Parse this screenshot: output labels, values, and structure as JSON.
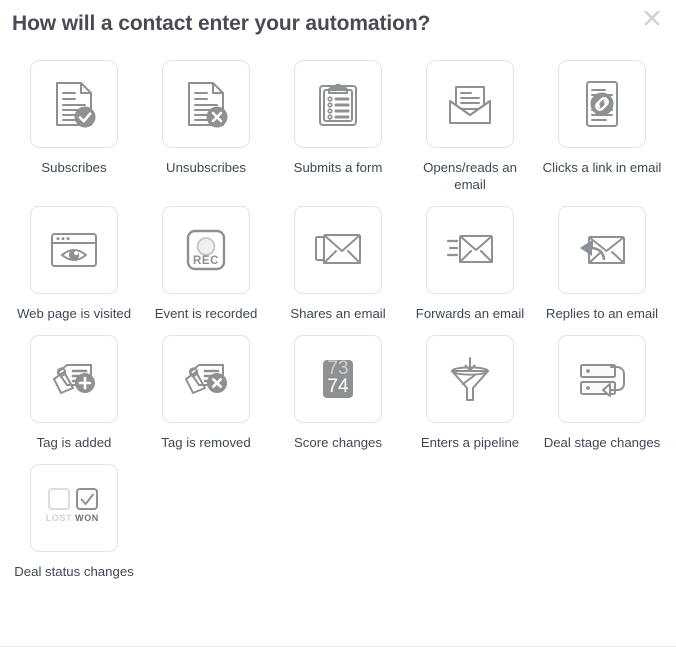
{
  "header": {
    "title": "How will a contact enter your automation?",
    "close_label": "×",
    "close_icon": "close-icon"
  },
  "colors": {
    "icon_stroke": "#8e9194",
    "icon_fill_gray": "#8e9194",
    "card_border": "#e3e3e3",
    "label_text": "#3e4855",
    "title_text": "#4a4a54",
    "close_icon": "#d2d2d2",
    "background": "#ffffff"
  },
  "score_icon": {
    "old_value": "73",
    "new_value": "74"
  },
  "deal_status_icon": {
    "lost_label": "LOST",
    "won_label": "WON"
  },
  "event_icon": {
    "rec_label": "REC"
  },
  "grid": {
    "items": [
      {
        "label": "Subscribes",
        "icon": "document-check-icon"
      },
      {
        "label": "Unsubscribes",
        "icon": "document-x-icon"
      },
      {
        "label": "Submits a form",
        "icon": "clipboard-form-icon"
      },
      {
        "label": "Opens/reads an email",
        "icon": "open-envelope-icon"
      },
      {
        "label": "Clicks a link in email",
        "icon": "document-link-icon"
      },
      {
        "label": "Web page is visited",
        "icon": "browser-eye-icon"
      },
      {
        "label": "Event is recorded",
        "icon": "record-button-icon"
      },
      {
        "label": "Shares an email",
        "icon": "share-envelopes-icon"
      },
      {
        "label": "Forwards an email",
        "icon": "forward-envelope-icon"
      },
      {
        "label": "Replies to an email",
        "icon": "reply-envelope-icon"
      },
      {
        "label": "Tag is added",
        "icon": "tag-plus-icon"
      },
      {
        "label": "Tag is removed",
        "icon": "tag-x-icon"
      },
      {
        "label": "Score changes",
        "icon": "score-counter-icon"
      },
      {
        "label": "Enters a pipeline",
        "icon": "funnel-icon"
      },
      {
        "label": "Deal stage changes",
        "icon": "deal-stage-icon"
      },
      {
        "label": "Deal status changes",
        "icon": "deal-status-icon"
      }
    ]
  }
}
